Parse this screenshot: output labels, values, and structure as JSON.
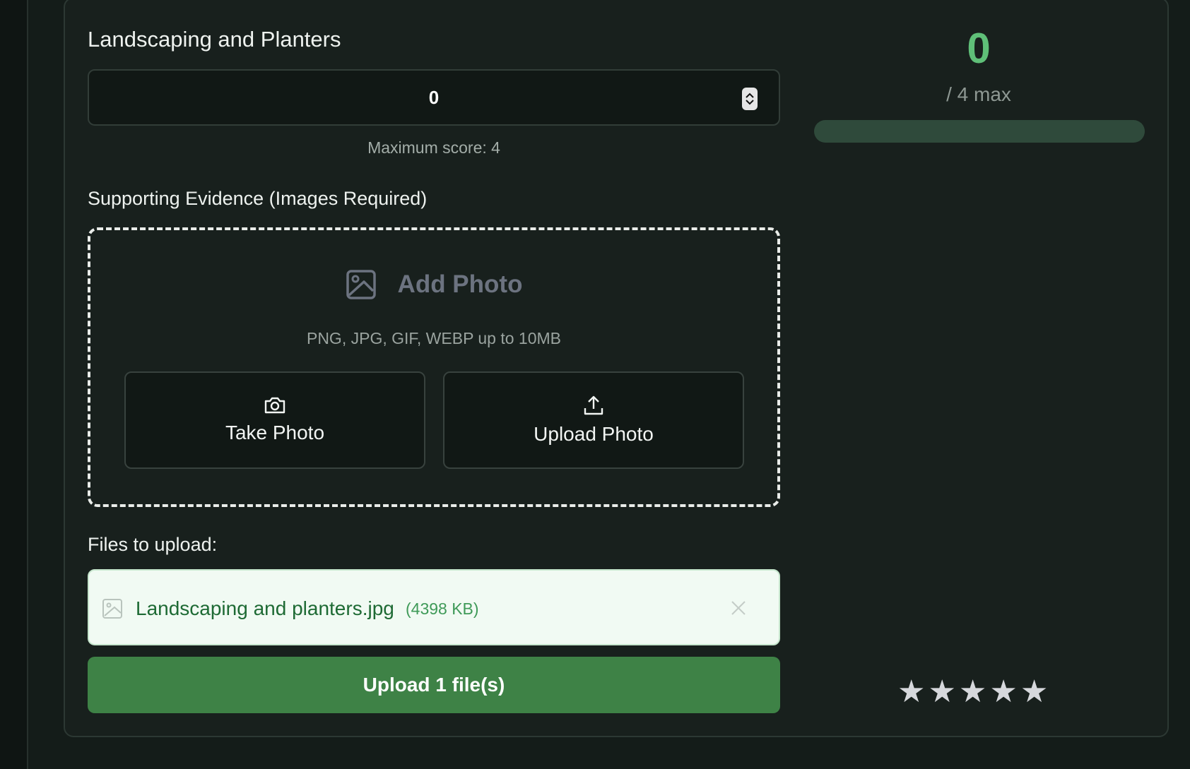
{
  "section": {
    "title": "Landscaping and Planters",
    "score_input_value": "0",
    "max_hint": "Maximum score: 4"
  },
  "evidence": {
    "label": "Supporting Evidence (Images Required)",
    "add_photo_label": "Add Photo",
    "formats": "PNG, JPG, GIF, WEBP up to 10MB",
    "take_photo_label": "Take Photo",
    "upload_photo_label": "Upload Photo",
    "icons": {
      "add_photo": "image-icon",
      "take_photo": "camera-icon",
      "upload_photo": "upload-icon"
    }
  },
  "files": {
    "label": "Files to upload:",
    "items": [
      {
        "name": "Landscaping and planters.jpg",
        "size": "(4398 KB)"
      }
    ],
    "upload_button_label": "Upload 1 file(s)"
  },
  "score_panel": {
    "score": "0",
    "max_text": "/ 4 max",
    "progress": 0,
    "rating_stars_filled": 0,
    "rating_stars_total": 5,
    "star_glyph": "★"
  },
  "colors": {
    "accent": "#5fbf78",
    "upload_button": "#3e8246",
    "background": "#141c19",
    "card": "#18201d"
  }
}
